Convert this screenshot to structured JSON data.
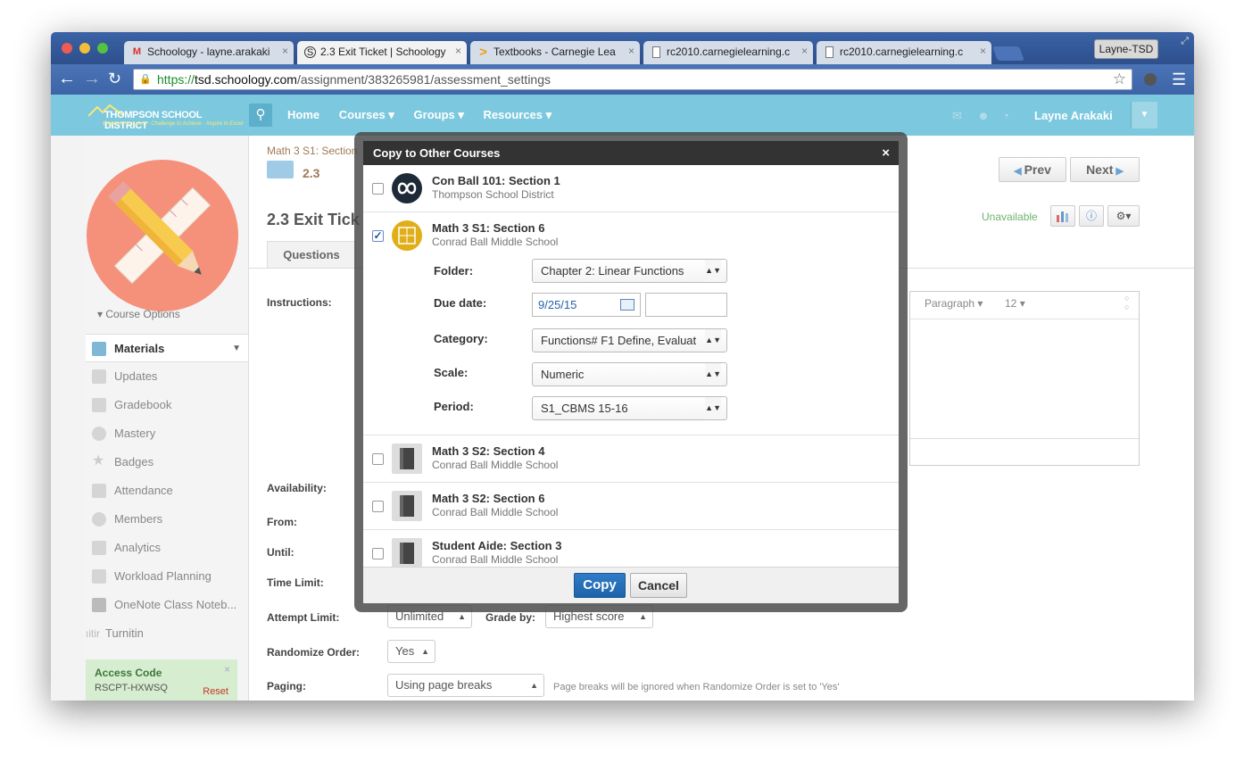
{
  "browser": {
    "tabs": [
      {
        "label": "Schoology - layne.arakaki",
        "icon": "gmail-icon"
      },
      {
        "label": "2.3 Exit Ticket | Schoology",
        "icon": "schoology-icon"
      },
      {
        "label": "Textbooks - Carnegie Lea",
        "icon": "carnegie-icon"
      },
      {
        "label": "rc2010.carnegielearning.c",
        "icon": "page-icon"
      },
      {
        "label": "rc2010.carnegielearning.c",
        "icon": "page-icon"
      }
    ],
    "tab_close": "×",
    "profile": "Layne-TSD",
    "url_scheme": "https://",
    "url_host": "tsd.schoology.com",
    "url_path": "/assignment/383265981/assessment_settings"
  },
  "header": {
    "logo_name": "THOMPSON SCHOOL DISTRICT",
    "logo_tagline": "Empower to Learn · Challenge to Achieve · Inspire to Excel",
    "nav": {
      "home": "Home",
      "courses": "Courses ▾",
      "groups": "Groups ▾",
      "resources": "Resources ▾"
    },
    "user_name": "Layne Arakaki"
  },
  "sidebar": {
    "course_options": "▾  Course Options",
    "items": [
      {
        "label": "Materials"
      },
      {
        "label": "Updates"
      },
      {
        "label": "Gradebook"
      },
      {
        "label": "Mastery"
      },
      {
        "label": "Badges"
      },
      {
        "label": "Attendance"
      },
      {
        "label": "Members"
      },
      {
        "label": "Analytics"
      },
      {
        "label": "Workload Planning"
      },
      {
        "label": "OneNote Class Noteb..."
      },
      {
        "label": "Turnitin",
        "prefix": "ıitir"
      }
    ],
    "access_code": {
      "title": "Access Code",
      "code": "RSCPT-HXWSQ",
      "reset": "Reset",
      "close": "×"
    }
  },
  "main": {
    "breadcrumb": "Math 3 S1: Section",
    "folder": "2.3",
    "prev": "Prev",
    "next": "Next",
    "title": "2.3 Exit Tick",
    "status": "Unavailable",
    "tab_questions": "Questions",
    "labels": {
      "instructions": "Instructions:",
      "availability": "Availability:",
      "from": "From:",
      "until": "Until:",
      "time_limit": "Time Limit:",
      "attempt_limit": "Attempt Limit:",
      "grade_by": "Grade by:",
      "randomize": "Randomize Order:",
      "paging": "Paging:"
    },
    "values": {
      "attempt_limit": "Unlimited",
      "grade_by": "Highest score",
      "randomize": "Yes",
      "paging": "Using page breaks"
    },
    "paging_hint": "Page breaks will be ignored when Randomize Order is set to 'Yes'",
    "editor": {
      "format": "Paragraph",
      "size": "12"
    }
  },
  "modal": {
    "title": "Copy to Other Courses",
    "close": "×",
    "courses": [
      {
        "name": "Con Ball 101: Section 1",
        "school": "Thompson School District",
        "checked": false
      },
      {
        "name": "Math 3 S1: Section 6",
        "school": "Conrad Ball Middle School",
        "checked": true
      },
      {
        "name": "Math 3 S2: Section 4",
        "school": "Conrad Ball Middle School",
        "checked": false
      },
      {
        "name": "Math 3 S2: Section 6",
        "school": "Conrad Ball Middle School",
        "checked": false
      },
      {
        "name": "Student Aide: Section 3",
        "school": "Conrad Ball Middle School",
        "checked": false
      }
    ],
    "fields": {
      "folder_label": "Folder:",
      "folder_value": "Chapter 2: Linear Functions",
      "due_label": "Due date:",
      "due_value": "9/25/15",
      "category_label": "Category:",
      "category_value": "Functions# F1 Define, Evaluat",
      "scale_label": "Scale:",
      "scale_value": "Numeric",
      "period_label": "Period:",
      "period_value": "S1_CBMS 15-16"
    },
    "copy_label": "Copy",
    "cancel_label": "Cancel"
  }
}
